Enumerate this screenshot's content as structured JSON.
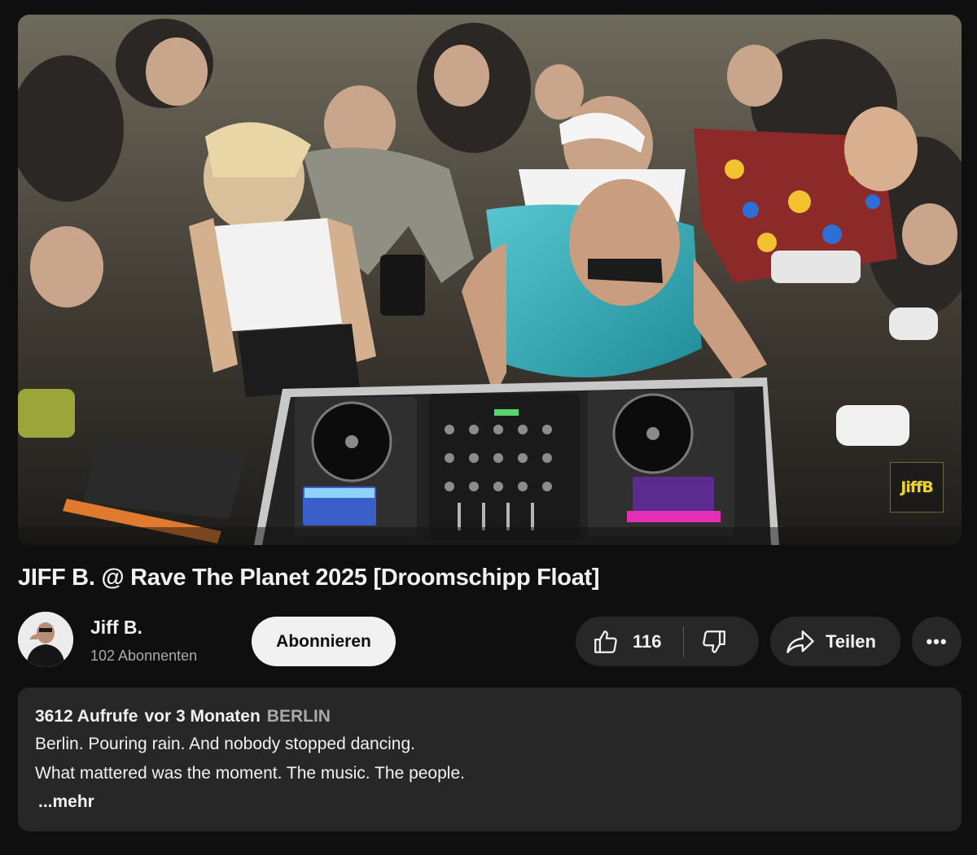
{
  "video": {
    "watermark_text": "JiffB",
    "title": "JIFF B. @ Rave The Planet 2025 [Droomschipp Float]"
  },
  "channel": {
    "name": "Jiff B.",
    "subscribers": "102 Abonnenten",
    "subscribe_label": "Abonnieren"
  },
  "actions": {
    "like_count": "116",
    "share_label": "Teilen",
    "more_label": "•••"
  },
  "description": {
    "views": "3612 Aufrufe",
    "date": "vor 3 Monaten",
    "location": "BERLIN",
    "lines": [
      "Berlin. Pouring rain. And nobody stopped dancing.",
      "What mattered was the moment. The music. The people."
    ],
    "more_link": "...mehr"
  },
  "colors": {
    "background": "#0f0f0f",
    "surface": "#272727",
    "text": "#f1f1f1",
    "muted": "#aaaaaa",
    "subscribe_bg": "#f1f1f1"
  }
}
